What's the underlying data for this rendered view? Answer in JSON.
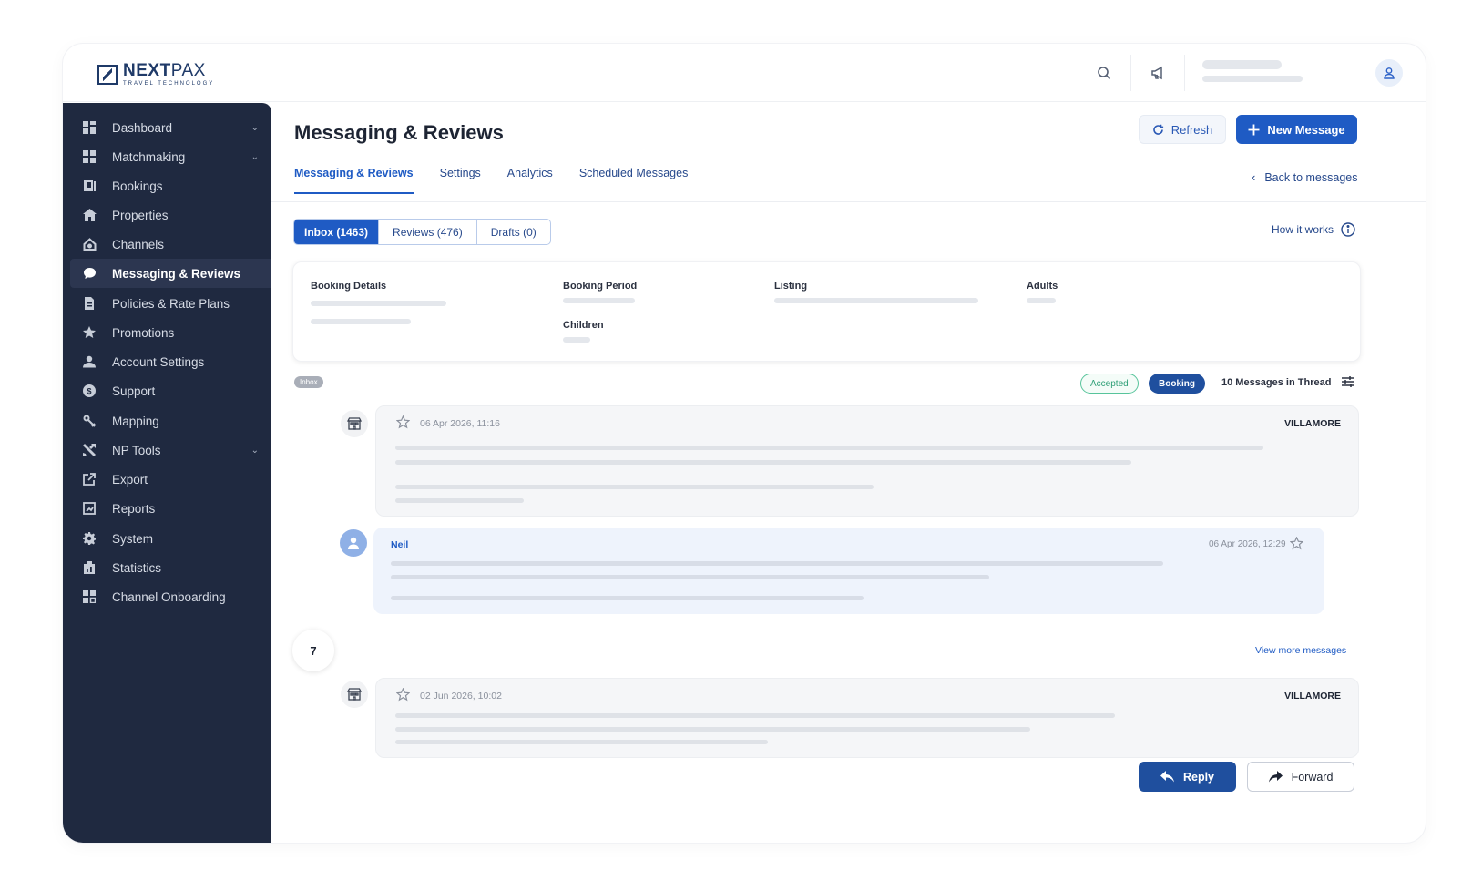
{
  "brand": {
    "name_bold": "NEXT",
    "name_light": "PAX",
    "tagline": "TRAVEL TECHNOLOGY"
  },
  "topbar": {
    "search_icon": "search-icon",
    "announce_icon": "megaphone-icon",
    "user_icon": "user-icon"
  },
  "sidebar": {
    "items": [
      {
        "label": "Dashboard",
        "icon": "grid-icon",
        "has_chevron": true
      },
      {
        "label": "Matchmaking",
        "icon": "grid-icon",
        "has_chevron": true
      },
      {
        "label": "Bookings",
        "icon": "book-icon",
        "has_chevron": false
      },
      {
        "label": "Properties",
        "icon": "home-icon",
        "has_chevron": false
      },
      {
        "label": "Channels",
        "icon": "channels-icon",
        "has_chevron": false
      },
      {
        "label": "Messaging & Reviews",
        "icon": "chat-icon",
        "has_chevron": false,
        "active": true
      },
      {
        "label": "Policies & Rate Plans",
        "icon": "policy-icon",
        "has_chevron": false
      },
      {
        "label": "Promotions",
        "icon": "star-icon",
        "has_chevron": false
      },
      {
        "label": "Account Settings",
        "icon": "account-icon",
        "has_chevron": false
      },
      {
        "label": "Support",
        "icon": "support-icon",
        "has_chevron": false
      },
      {
        "label": "Mapping",
        "icon": "mapping-icon",
        "has_chevron": false
      },
      {
        "label": "NP Tools",
        "icon": "tools-icon",
        "has_chevron": true
      },
      {
        "label": "Export",
        "icon": "export-icon",
        "has_chevron": false
      },
      {
        "label": "Reports",
        "icon": "reports-icon",
        "has_chevron": false
      },
      {
        "label": "System",
        "icon": "gear-icon",
        "has_chevron": false
      },
      {
        "label": "Statistics",
        "icon": "statistics-icon",
        "has_chevron": false
      },
      {
        "label": "Channel Onboarding",
        "icon": "onboarding-icon",
        "has_chevron": false
      }
    ]
  },
  "header": {
    "title": "Messaging & Reviews",
    "refresh_label": "Refresh",
    "new_message_label": "New Message",
    "back_label": "Back to messages"
  },
  "tabs": [
    {
      "label": "Messaging & Reviews",
      "active": true
    },
    {
      "label": "Settings"
    },
    {
      "label": "Analytics"
    },
    {
      "label": "Scheduled Messages"
    }
  ],
  "segments": [
    {
      "label": "Inbox (1463)",
      "active": true
    },
    {
      "label": "Reviews (476)"
    },
    {
      "label": "Drafts (0)"
    }
  ],
  "how_it_works": "How it works",
  "details": {
    "booking_details": "Booking Details",
    "booking_period": "Booking Period",
    "listing": "Listing",
    "adults": "Adults",
    "children": "Children"
  },
  "thread": {
    "folder_badge": "Inbox",
    "status_badge": "Accepted",
    "type_badge": "Booking",
    "count_label": "10 Messages in Thread",
    "messages": [
      {
        "date": "06 Apr 2026, 11:16",
        "sender": "VILLAMORE"
      },
      {
        "name": "Neil",
        "date": "06 Apr 2026, 12:29"
      },
      {
        "date": "02 Jun 2026, 10:02",
        "sender": "VILLAMORE"
      }
    ],
    "hidden_count": "7",
    "view_more": "View more messages"
  },
  "actions": {
    "reply": "Reply",
    "forward": "Forward"
  },
  "colors": {
    "primary": "#1f5bc4",
    "sidebar_bg": "#1f2940",
    "accepted": "#2f9f77"
  }
}
